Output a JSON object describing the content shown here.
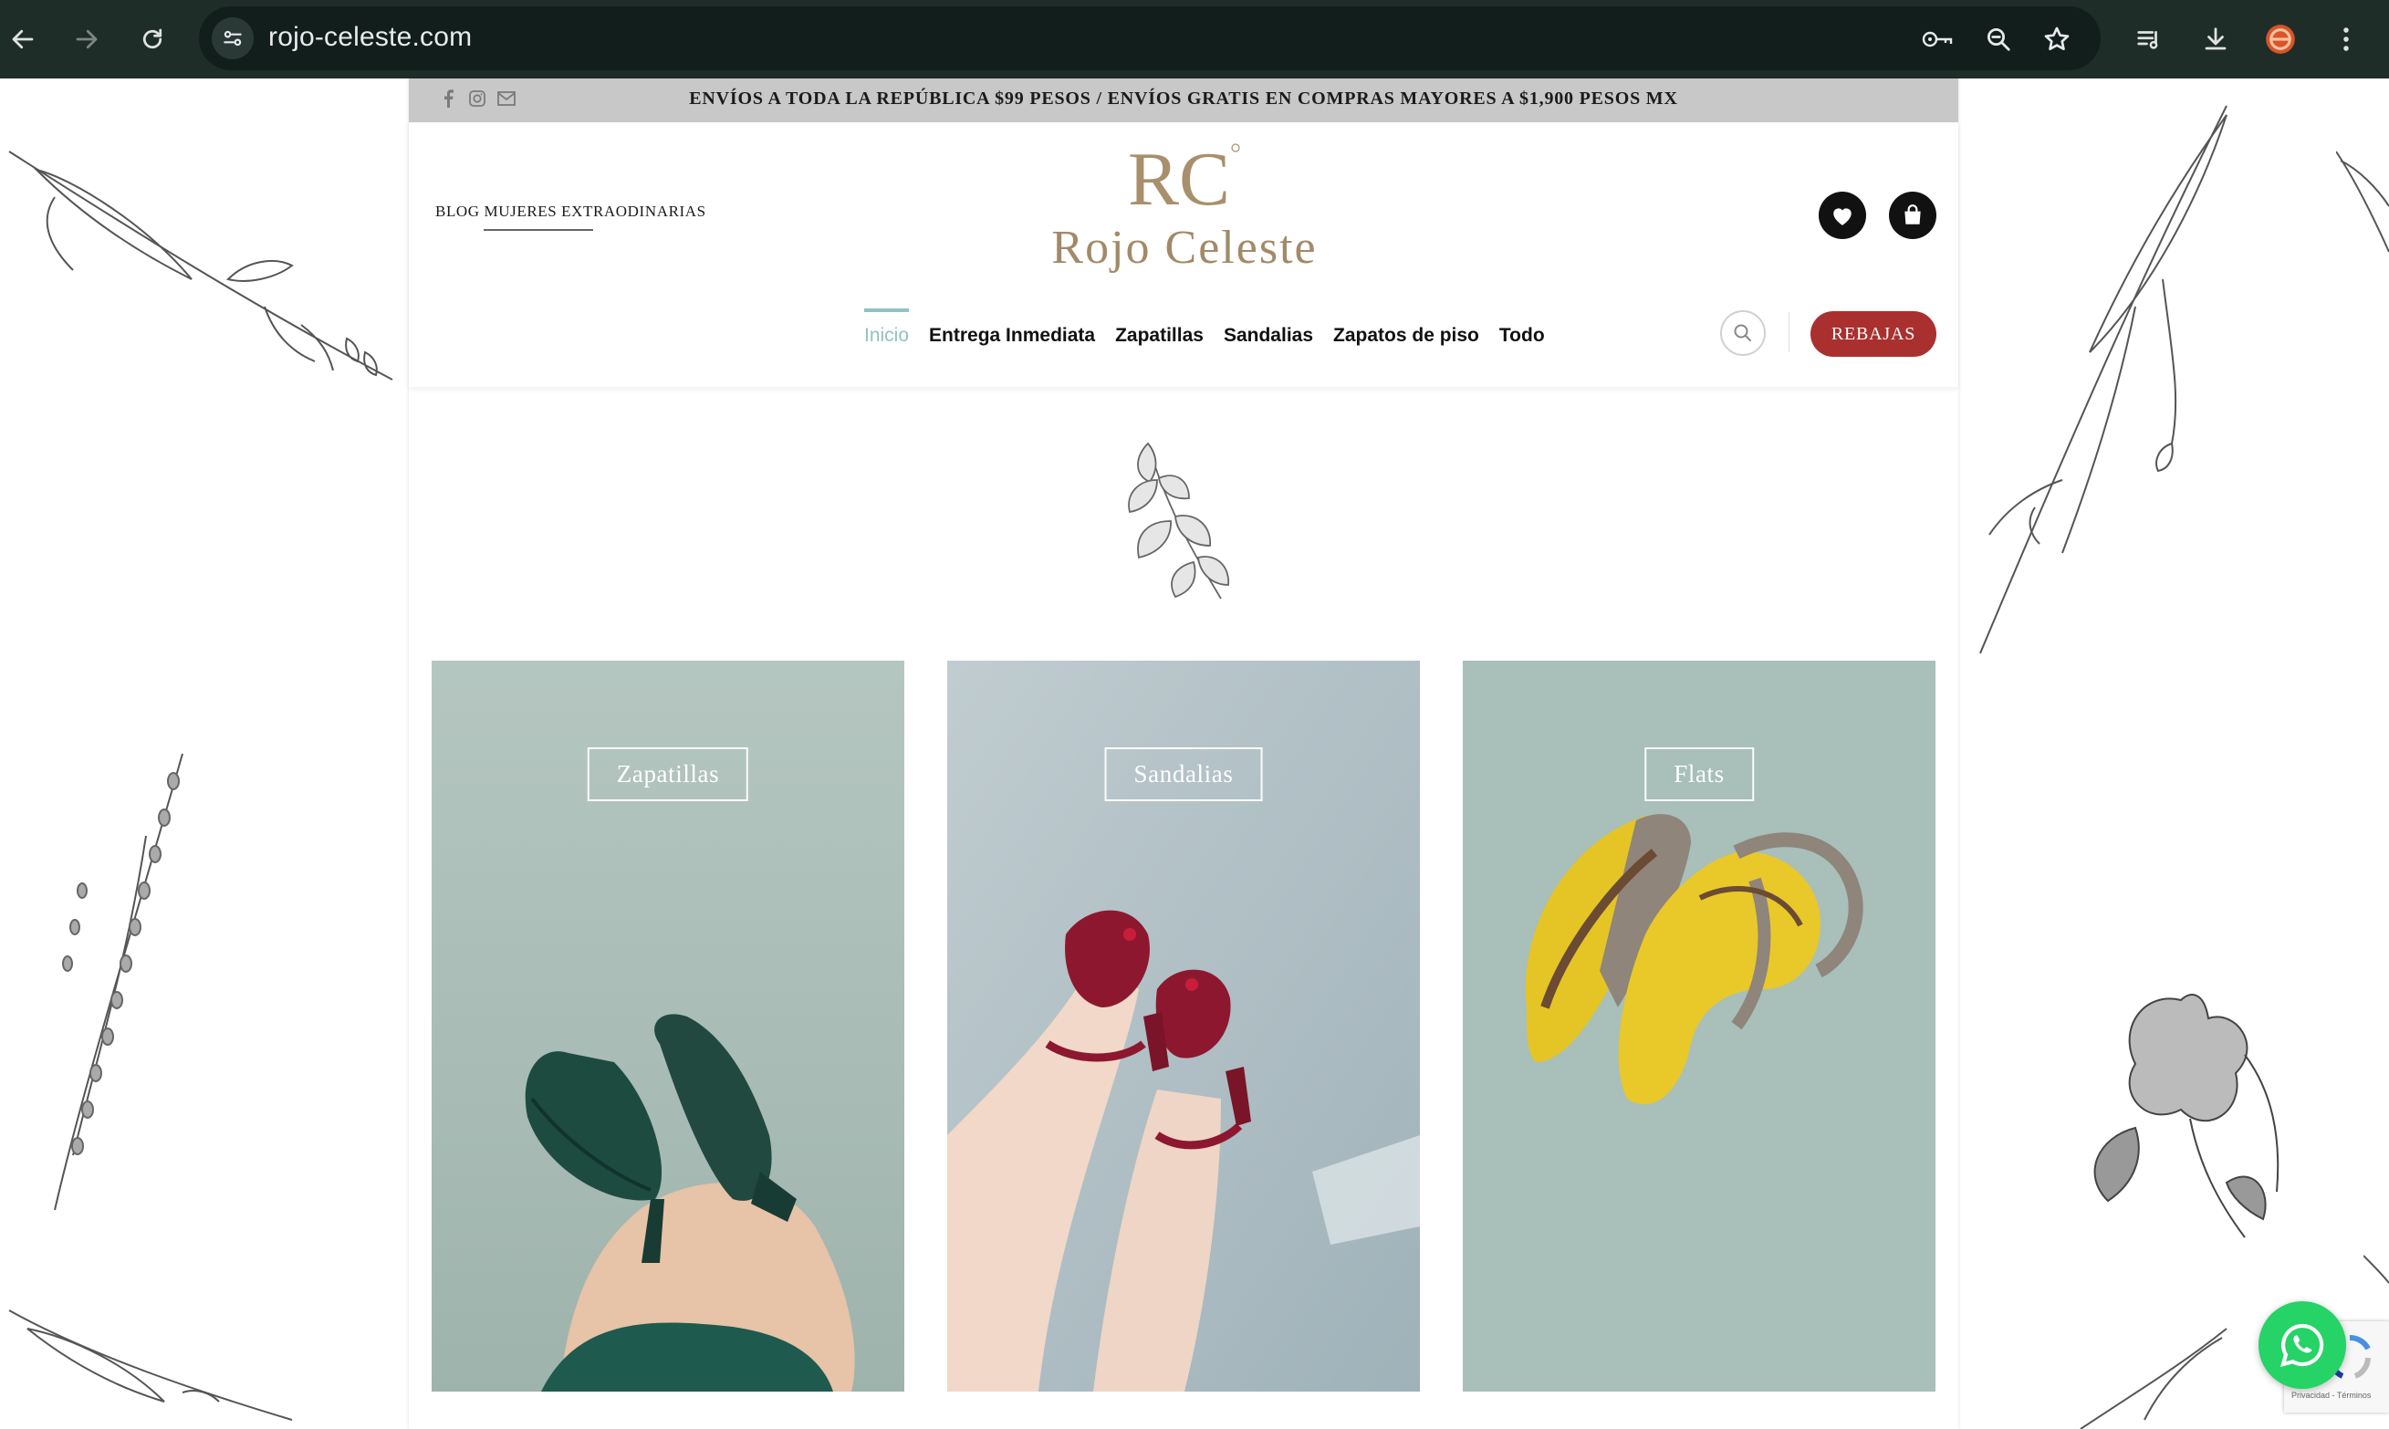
{
  "browser": {
    "url": "rojo-celeste.com",
    "icons": [
      "back-arrow-icon",
      "forward-arrow-icon",
      "reload-icon",
      "site-settings-icon",
      "password-key-icon",
      "zoom-out-icon",
      "bookmark-star-icon",
      "media-queue-icon",
      "download-icon",
      "extension-icon",
      "menu-dots-icon"
    ]
  },
  "site": {
    "topbar": {
      "social_icons": [
        "facebook-icon",
        "instagram-icon",
        "email-icon"
      ],
      "announcement": "ENVÍOS A TODA LA REPÚBLICA $99 PESOS / ENVÍOS GRATIS EN COMPRAS MAYORES A $1,900 PESOS MX"
    },
    "header": {
      "blog_link": "BLOG MUJERES EXTRAODINARIAS",
      "logo_monogram": "RC",
      "logo_text": "Rojo Celeste",
      "wishlist_icon": "heart-icon",
      "cart_icon": "shopping-bag-icon"
    },
    "menu": {
      "items": [
        "Inicio",
        "Entrega Inmediata",
        "Zapatillas",
        "Sandalias",
        "Zapatos de piso",
        "Todo"
      ],
      "active_index": 0,
      "sale_button": "REBAJAS"
    },
    "categories": [
      {
        "label": "Zapatillas"
      },
      {
        "label": "Sandalias"
      },
      {
        "label": "Flats"
      }
    ],
    "floating": {
      "whatsapp_icon": "whatsapp-icon",
      "recaptcha_text": "Privacidad - Términos"
    }
  },
  "colors": {
    "chrome_bg": "#1f2d29",
    "accent_teal": "#8fc3c1",
    "sale_red": "#a9302e",
    "logo_gold": "#a28a68",
    "whatsapp_green": "#25d366"
  }
}
